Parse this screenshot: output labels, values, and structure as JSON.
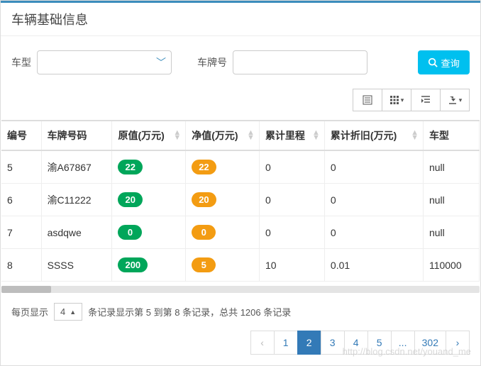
{
  "header": {
    "title": "车辆基础信息"
  },
  "filter": {
    "type_label": "车型",
    "type_value": "",
    "plate_label": "车牌号",
    "plate_value": "",
    "query_label": "查询"
  },
  "table": {
    "columns": [
      "编号",
      "车牌号码",
      "原值(万元)",
      "净值(万元)",
      "累计里程",
      "累计折旧(万元)",
      "车型"
    ],
    "rows": [
      {
        "id": "5",
        "plate": "渝A67867",
        "orig": "22",
        "net": "22",
        "mileage": "0",
        "dep": "0",
        "type": "null"
      },
      {
        "id": "6",
        "plate": "渝C11222",
        "orig": "20",
        "net": "20",
        "mileage": "0",
        "dep": "0",
        "type": "null"
      },
      {
        "id": "7",
        "plate": "asdqwe",
        "orig": "0",
        "net": "0",
        "mileage": "0",
        "dep": "0",
        "type": "null"
      },
      {
        "id": "8",
        "plate": "SSSS",
        "orig": "200",
        "net": "5",
        "mileage": "10",
        "dep": "0.01",
        "type": "110000"
      }
    ]
  },
  "footer": {
    "per_page_label": "每页显示",
    "per_page_value": "4",
    "info": "条记录显示第 5 到第 8 条记录，总共 1206 条记录",
    "pages": [
      "‹",
      "1",
      "2",
      "3",
      "4",
      "5",
      "...",
      "302",
      "›"
    ],
    "active_page": "2"
  },
  "watermark": "http://blog.csdn.net/youand_me"
}
